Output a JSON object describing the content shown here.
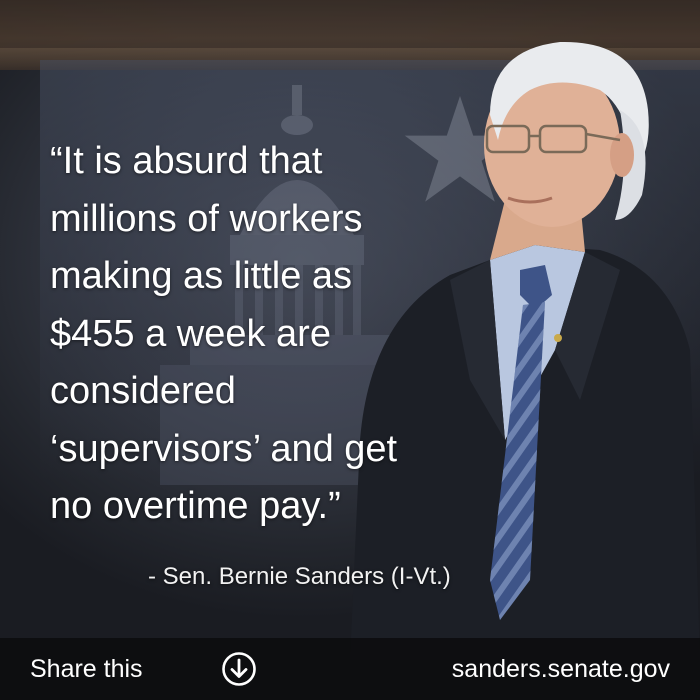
{
  "quote": {
    "lines": [
      "“It is absurd that",
      "millions of workers",
      "making as little as",
      "$455 a week are",
      "considered",
      "‘supervisors’ and get",
      "no overtime pay.”"
    ],
    "attribution": "- Sen. Bernie Sanders (I-Vt.)"
  },
  "footer": {
    "share_label": "Share this",
    "share_icon": "download-circle-icon",
    "site": "sanders.senate.gov"
  },
  "colors": {
    "text": "#ffffff",
    "footer_bg": "#0c0c0e",
    "suit": "#1c1f26",
    "shirt": "#b9c7e0",
    "tie": "#3e5488"
  }
}
